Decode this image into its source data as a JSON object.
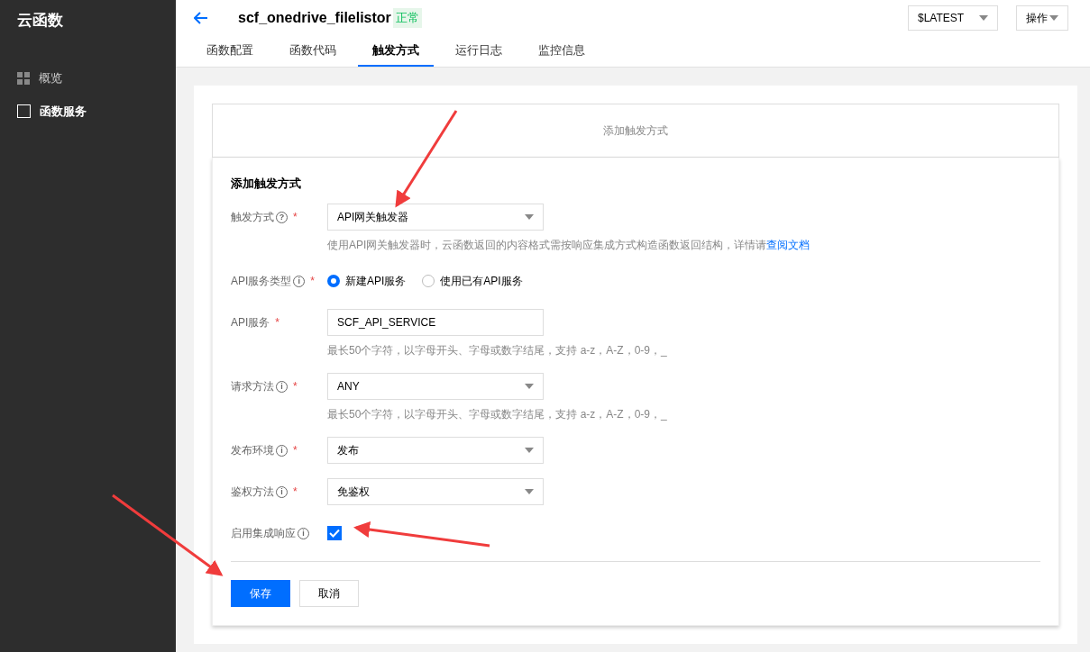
{
  "sidebar": {
    "title": "云函数",
    "items": [
      {
        "label": "概览",
        "selected": false
      },
      {
        "label": "函数服务",
        "selected": true
      }
    ]
  },
  "header": {
    "title": "scf_onedrive_filelistor",
    "status": "正常",
    "version": "$LATEST",
    "actions": "操作"
  },
  "tabs": [
    {
      "label": "函数配置",
      "selected": false
    },
    {
      "label": "函数代码",
      "selected": false
    },
    {
      "label": "触发方式",
      "selected": true
    },
    {
      "label": "运行日志",
      "selected": false
    },
    {
      "label": "监控信息",
      "selected": false
    }
  ],
  "add_trigger_bar": "添加触发方式",
  "form": {
    "title": "添加触发方式",
    "fields": [
      {
        "kind": "select",
        "label": "触发方式",
        "help": "?",
        "required_mark": "*",
        "value": "API网关触发器",
        "hint": "使用API网关触发器时，云函数返回的内容格式需按响应集成方式构造函数返回结构，详情请",
        "hint_link": "查阅文档"
      },
      {
        "kind": "radio",
        "label": "API服务类型",
        "help": "i",
        "required_mark": "*",
        "options": [
          {
            "label": "新建API服务",
            "selected": true
          },
          {
            "label": "使用已有API服务",
            "selected": false
          }
        ]
      },
      {
        "kind": "input",
        "label": "API服务",
        "required_mark": "*",
        "value": "SCF_API_SERVICE",
        "hint": "最长50个字符，以字母开头、字母或数字结尾，支持 a-z，A-Z，0-9，_"
      },
      {
        "kind": "select",
        "label": "请求方法",
        "help": "i",
        "required_mark": "*",
        "value": "ANY",
        "hint": "最长50个字符，以字母开头、字母或数字结尾，支持 a-z，A-Z，0-9，_"
      },
      {
        "kind": "select",
        "label": "发布环境",
        "help": "i",
        "required_mark": "*",
        "value": "发布"
      },
      {
        "kind": "select",
        "label": "鉴权方法",
        "help": "i",
        "required_mark": "*",
        "value": "免鉴权"
      },
      {
        "kind": "checkbox",
        "label": "启用集成响应",
        "help": "i",
        "checked": true
      }
    ],
    "buttons": [
      {
        "label": "保存",
        "kind": "primary"
      },
      {
        "label": "取消",
        "kind": "default"
      }
    ]
  }
}
